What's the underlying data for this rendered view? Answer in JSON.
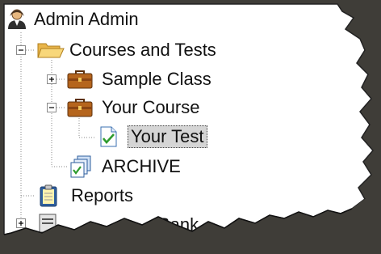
{
  "tree": {
    "root": {
      "label": "Admin Admin",
      "icon": "user-icon"
    },
    "courses": {
      "label": "Courses and Tests",
      "icon": "folder-open-icon",
      "expander": "minus"
    },
    "sample_class": {
      "label": "Sample Class",
      "icon": "briefcase-icon",
      "expander": "plus"
    },
    "your_course": {
      "label": "Your Course",
      "icon": "briefcase-icon",
      "expander": "minus"
    },
    "your_test": {
      "label": "Your Test",
      "icon": "document-check-icon",
      "selected": true
    },
    "archive": {
      "label": "ARCHIVE",
      "icon": "archive-pages-icon"
    },
    "reports": {
      "label": "Reports",
      "icon": "clipboard-icon"
    },
    "partial_item": {
      "label": "Bank",
      "icon": "list-icon",
      "expander": "plus"
    }
  },
  "colors": {
    "frame": "#3f3d38",
    "paper": "#ffffff",
    "selection": "#d5d5d5",
    "briefcase": "#b5651d",
    "folder": "#f3c85a"
  }
}
